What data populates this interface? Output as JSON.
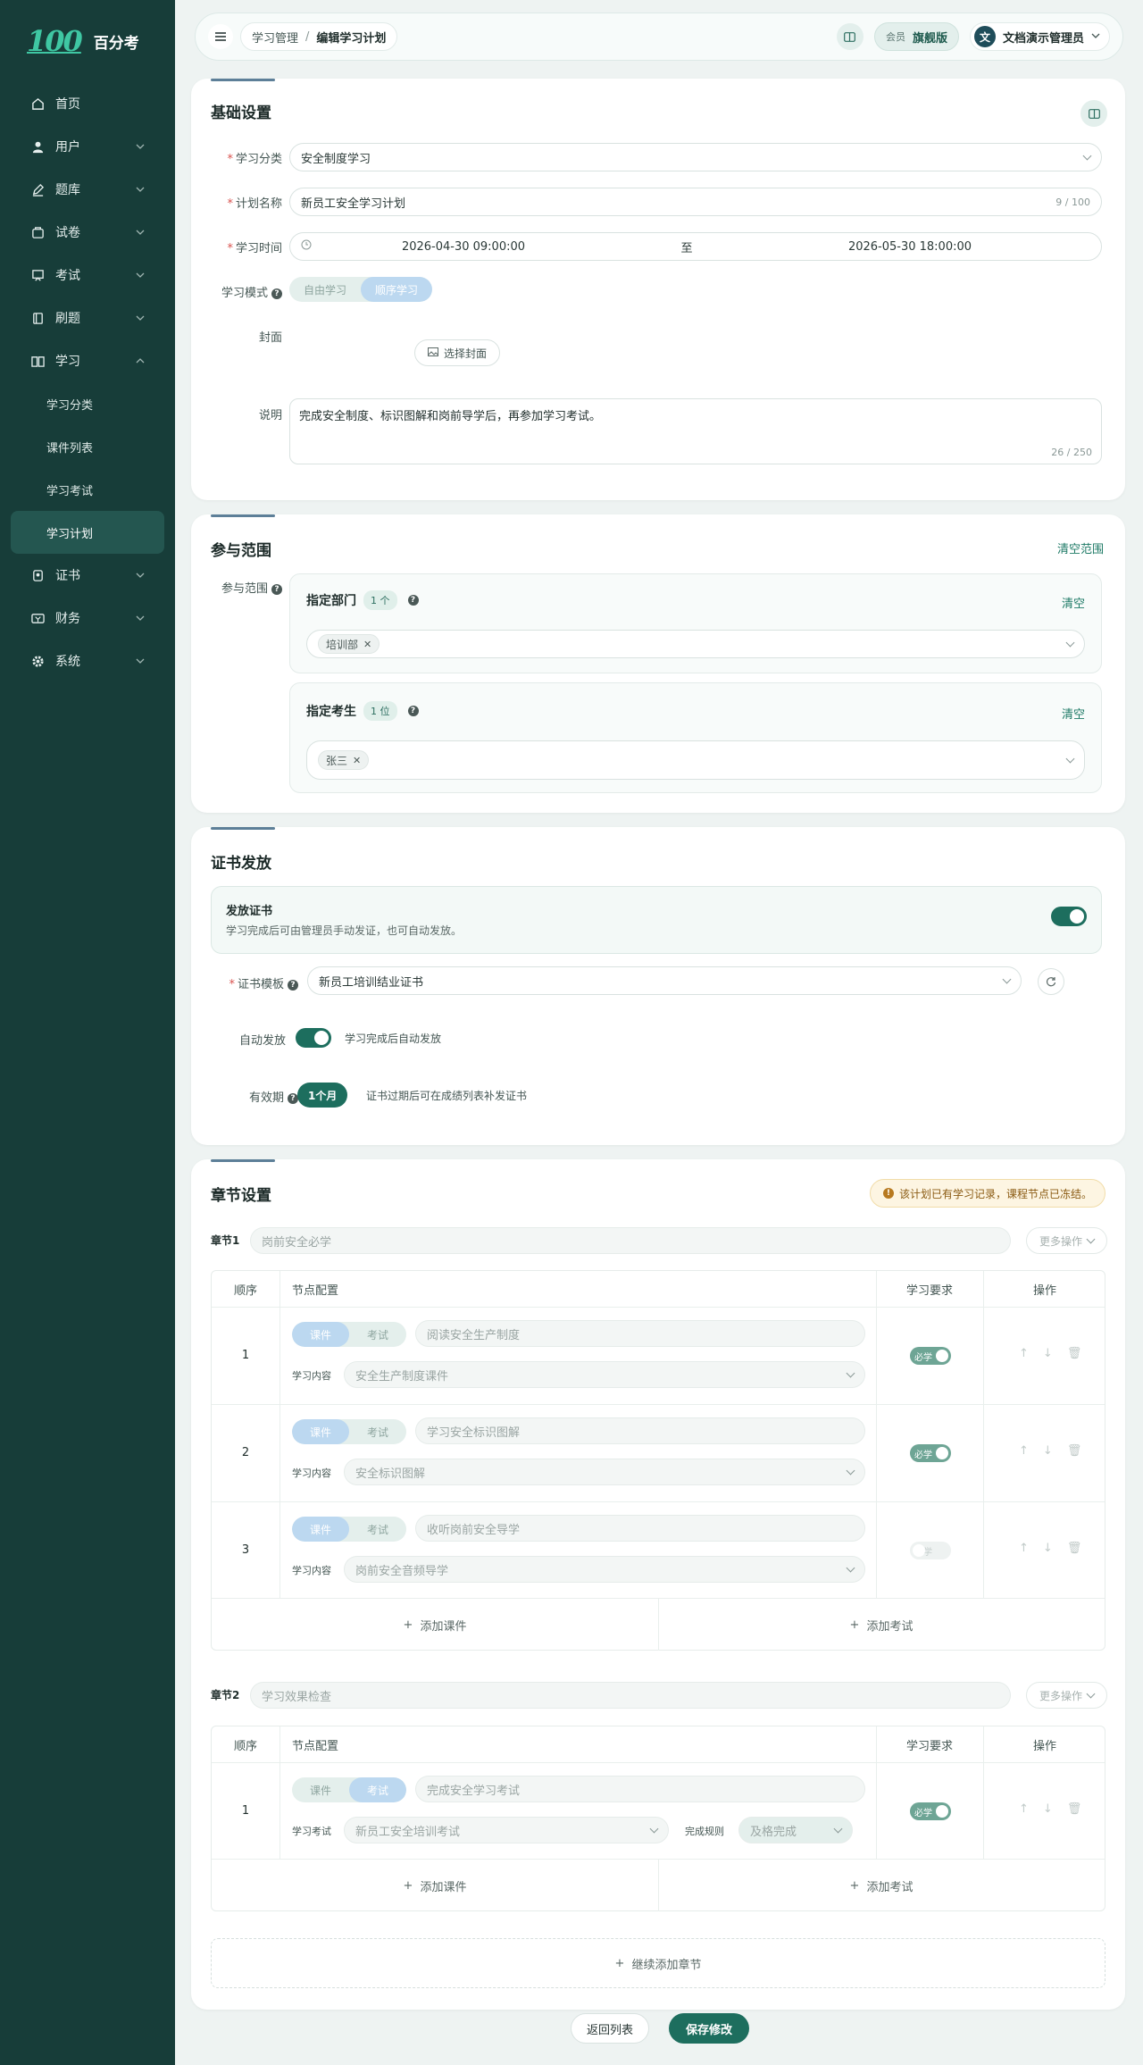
{
  "app": {
    "logo": "100",
    "name": "百分考"
  },
  "nav": [
    {
      "label": "首页",
      "icon": "home-icon"
    },
    {
      "label": "用户",
      "icon": "user-icon"
    },
    {
      "label": "题库",
      "icon": "pen-icon"
    },
    {
      "label": "试卷",
      "icon": "paper-icon"
    },
    {
      "label": "考试",
      "icon": "exam-icon"
    },
    {
      "label": "刷题",
      "icon": "book-icon"
    },
    {
      "label": "学习",
      "icon": "study-icon"
    }
  ],
  "nav_sub": [
    "学习分类",
    "课件列表",
    "学习考试",
    "学习计划"
  ],
  "nav_after": [
    {
      "label": "证书",
      "icon": "cert-icon"
    },
    {
      "label": "财务",
      "icon": "wallet-icon"
    },
    {
      "label": "系统",
      "icon": "gear-icon"
    }
  ],
  "topbar": {
    "crumb1": "学习管理",
    "sep": "/",
    "crumb2": "编辑学习计划",
    "member_label": "会员",
    "member_level": "旗舰版",
    "avatar": "文",
    "user": "文档演示管理员"
  },
  "basic": {
    "title": "基础设置",
    "category_label": "学习分类",
    "category_value": "安全制度学习",
    "name_label": "计划名称",
    "name_value": "新员工安全学习计划",
    "name_count": "9 / 100",
    "time_label": "学习时间",
    "time_start": "2026-04-30 09:00:00",
    "time_sep": "至",
    "time_end": "2026-05-30 18:00:00",
    "mode_label": "学习模式",
    "mode_free": "自由学习",
    "mode_seq": "顺序学习",
    "cover_label": "封面",
    "cover_btn": "选择封面",
    "desc_label": "说明",
    "desc_value": "完成安全制度、标识图解和岗前导学后，再参加学习考试。",
    "desc_count": "26 / 250"
  },
  "scope": {
    "title": "参与范围",
    "clear_all": "清空范围",
    "label": "参与范围",
    "dept_title": "指定部门",
    "dept_count": "1 个",
    "dept_clear": "清空",
    "dept_tag": "培训部",
    "stu_title": "指定考生",
    "stu_count": "1 位",
    "stu_clear": "清空",
    "stu_tag": "张三"
  },
  "cert": {
    "title": "证书发放",
    "issue_title": "发放证书",
    "issue_desc": "学习完成后可由管理员手动发证，也可自动发放。",
    "template_label": "证书模板",
    "template_value": "新员工培训结业证书",
    "auto_label": "自动发放",
    "auto_desc": "学习完成后自动发放",
    "valid_label": "有效期",
    "valid_value": "1个月",
    "valid_desc": "证书过期后可在成绩列表补发证书"
  },
  "chapters": {
    "title": "章节设置",
    "notice": "该计划已有学习记录，课程节点已冻结。",
    "more": "更多操作",
    "add_course": "添加课件",
    "add_exam": "添加考试",
    "add_chapter": "继续添加章节",
    "headers": {
      "order": "顺序",
      "config": "节点配置",
      "req": "学习要求",
      "ops": "操作"
    },
    "seg_course": "课件",
    "seg_exam": "考试",
    "required": "必学",
    "ch1": {
      "label": "章节1",
      "name": "岗前安全必学",
      "rows": [
        {
          "no": "1",
          "title": "阅读安全生产制度",
          "content_label": "学习内容",
          "content": "安全生产制度课件"
        },
        {
          "no": "2",
          "title": "学习安全标识图解",
          "content_label": "学习内容",
          "content": "安全标识图解"
        },
        {
          "no": "3",
          "title": "收听岗前安全导学",
          "content_label": "学习内容",
          "content": "岗前安全音频导学"
        }
      ]
    },
    "ch2": {
      "label": "章节2",
      "name": "学习效果检查",
      "rows": [
        {
          "no": "1",
          "title": "完成安全学习考试",
          "content_label": "学习考试",
          "content": "新员工安全培训考试",
          "rule_label": "完成规则",
          "rule": "及格完成"
        }
      ]
    }
  },
  "footer": {
    "back": "返回列表",
    "save": "保存修改"
  },
  "colors": {
    "sidebar": "#173d39",
    "accent": "#1d6e5e",
    "primary_btn": "#1d6e5e"
  }
}
